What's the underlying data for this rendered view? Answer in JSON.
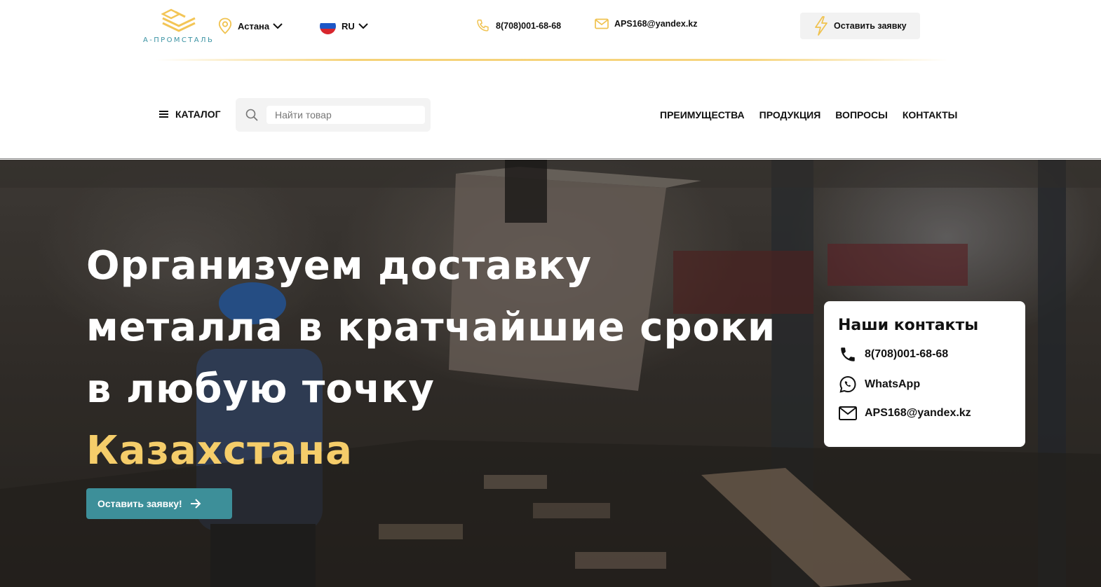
{
  "header": {
    "logo_text": "А-ПРОМСТАЛЬ",
    "city": "Астана",
    "language": "RU",
    "phone": "8(708)001-68-68",
    "email": "APS168@yandex.kz",
    "request_button": "Оставить заявку"
  },
  "nav": {
    "catalog": "КАТАЛОГ",
    "search_placeholder": "Найти товар",
    "menu": [
      "ПРЕИМУЩЕСТВА",
      "ПРОДУКЦИЯ",
      "ВОПРОСЫ",
      "КОНТАКТЫ"
    ]
  },
  "hero": {
    "title_line1": "Организуем доставку",
    "title_line2": "металла в кратчайшие сроки",
    "title_line3": "в любую точку",
    "title_accent": "Казахстана",
    "cta": "Оставить заявку!"
  },
  "contacts_card": {
    "title": "Наши контакты",
    "phone": "8(708)001-68-68",
    "whatsapp": "WhatsApp",
    "email": "APS168@yandex.kz"
  },
  "colors": {
    "accent_gold": "#f5cd6a",
    "teal": "#3d8f99"
  },
  "icons": [
    "logo-mark-icon",
    "location-pin-icon",
    "chevron-down-icon",
    "flag-ru-icon",
    "phone-icon",
    "mail-icon",
    "lightning-icon",
    "hamburger-icon",
    "search-icon",
    "arrow-right-icon",
    "whatsapp-icon"
  ]
}
